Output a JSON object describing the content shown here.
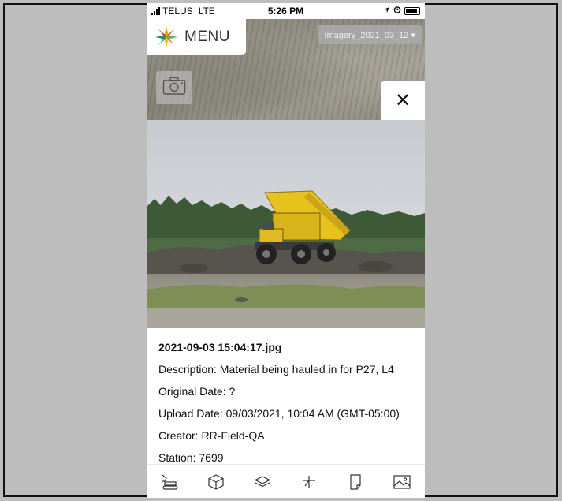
{
  "status_bar": {
    "carrier": "TELUS",
    "network": "LTE",
    "time": "5:26 PM"
  },
  "map": {
    "menu_label": "MENU",
    "imagery_selector": "Imagery_2021_03_12 ▾",
    "close_symbol": "✕"
  },
  "photo_details": {
    "filename": "2021-09-03 15:04:17.jpg",
    "description": "Description: Material being hauled in for P27, L4",
    "original_date": "Original Date: ?",
    "upload_date": "Upload Date: 09/03/2021, 10:04 AM (GMT-05:00)",
    "creator": "Creator: RR-Field-QA",
    "station": "Station: 7699"
  },
  "toolbar": {
    "items": [
      "excavator-icon",
      "box-3d-icon",
      "layers-icon",
      "measure-icon",
      "note-icon",
      "image-icon"
    ]
  },
  "colors": {
    "accent_yellow": "#e8c21c",
    "background_gray": "#bdbdbd"
  }
}
